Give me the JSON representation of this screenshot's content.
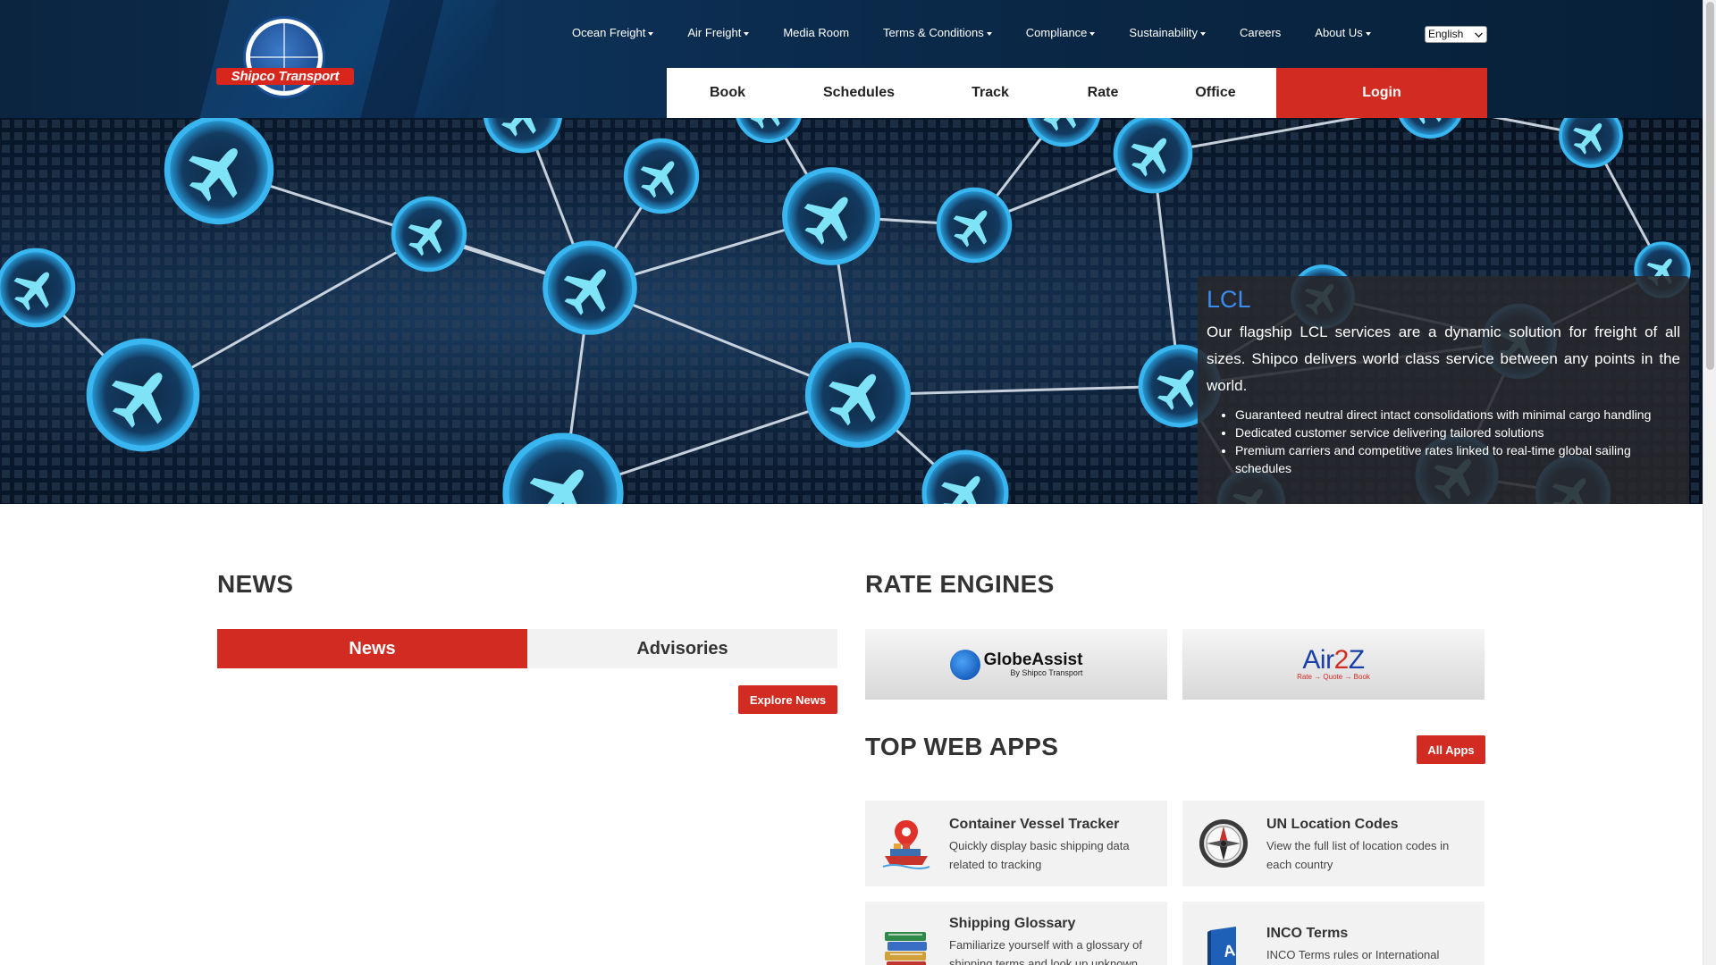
{
  "header": {
    "logo_text": "Shipco Transport",
    "top_nav": [
      {
        "label": "Ocean Freight",
        "dropdown": true
      },
      {
        "label": "Air Freight",
        "dropdown": true
      },
      {
        "label": "Media Room",
        "dropdown": false
      },
      {
        "label": "Terms & Conditions",
        "dropdown": true
      },
      {
        "label": "Compliance",
        "dropdown": true
      },
      {
        "label": "Sustainability",
        "dropdown": true
      },
      {
        "label": "Careers",
        "dropdown": false
      },
      {
        "label": "About Us",
        "dropdown": true
      }
    ],
    "language": "English",
    "actions": {
      "book": "Book",
      "schedules": "Schedules",
      "track": "Track",
      "rate": "Rate",
      "office": "Office",
      "login": "Login"
    }
  },
  "hero": {
    "title": "LCL",
    "description": "Our flagship LCL services are a dynamic solution for freight of all sizes. Shipco delivers world class service between any points in the world.",
    "bullets": [
      "Guaranteed neutral direct intact consolidations with minimal cargo handling",
      "Dedicated customer service delivering tailored solutions",
      "Premium carriers and competitive rates linked to real-time global sailing schedules"
    ]
  },
  "news": {
    "title": "NEWS",
    "tabs": [
      "News",
      "Advisories"
    ],
    "explore_button": "Explore News"
  },
  "rate_engines": {
    "title": "RATE ENGINES",
    "globeassist": {
      "name": "GlobeAssist",
      "tagline": "By Shipco Transport"
    },
    "air2z": {
      "prefix": "Air",
      "two": "2",
      "suffix": "Z",
      "tagline": "Rate → Quote → Book"
    }
  },
  "web_apps": {
    "title": "TOP WEB APPS",
    "all_apps_button": "All Apps",
    "apps": [
      {
        "title": "Container Vessel Tracker",
        "desc": "Quickly display basic shipping data related to tracking"
      },
      {
        "title": "UN Location Codes",
        "desc": "View the full list of location codes in each country"
      },
      {
        "title": "Shipping Glossary",
        "desc": "Familiarize yourself with a glossary of shipping terms and look up unknown"
      },
      {
        "title": "INCO Terms",
        "desc": "INCO Terms rules or International"
      }
    ]
  },
  "colors": {
    "brand_red": "#d12b22",
    "header_navy": "#0b2440",
    "lcl_blue": "#3b8cf0"
  }
}
